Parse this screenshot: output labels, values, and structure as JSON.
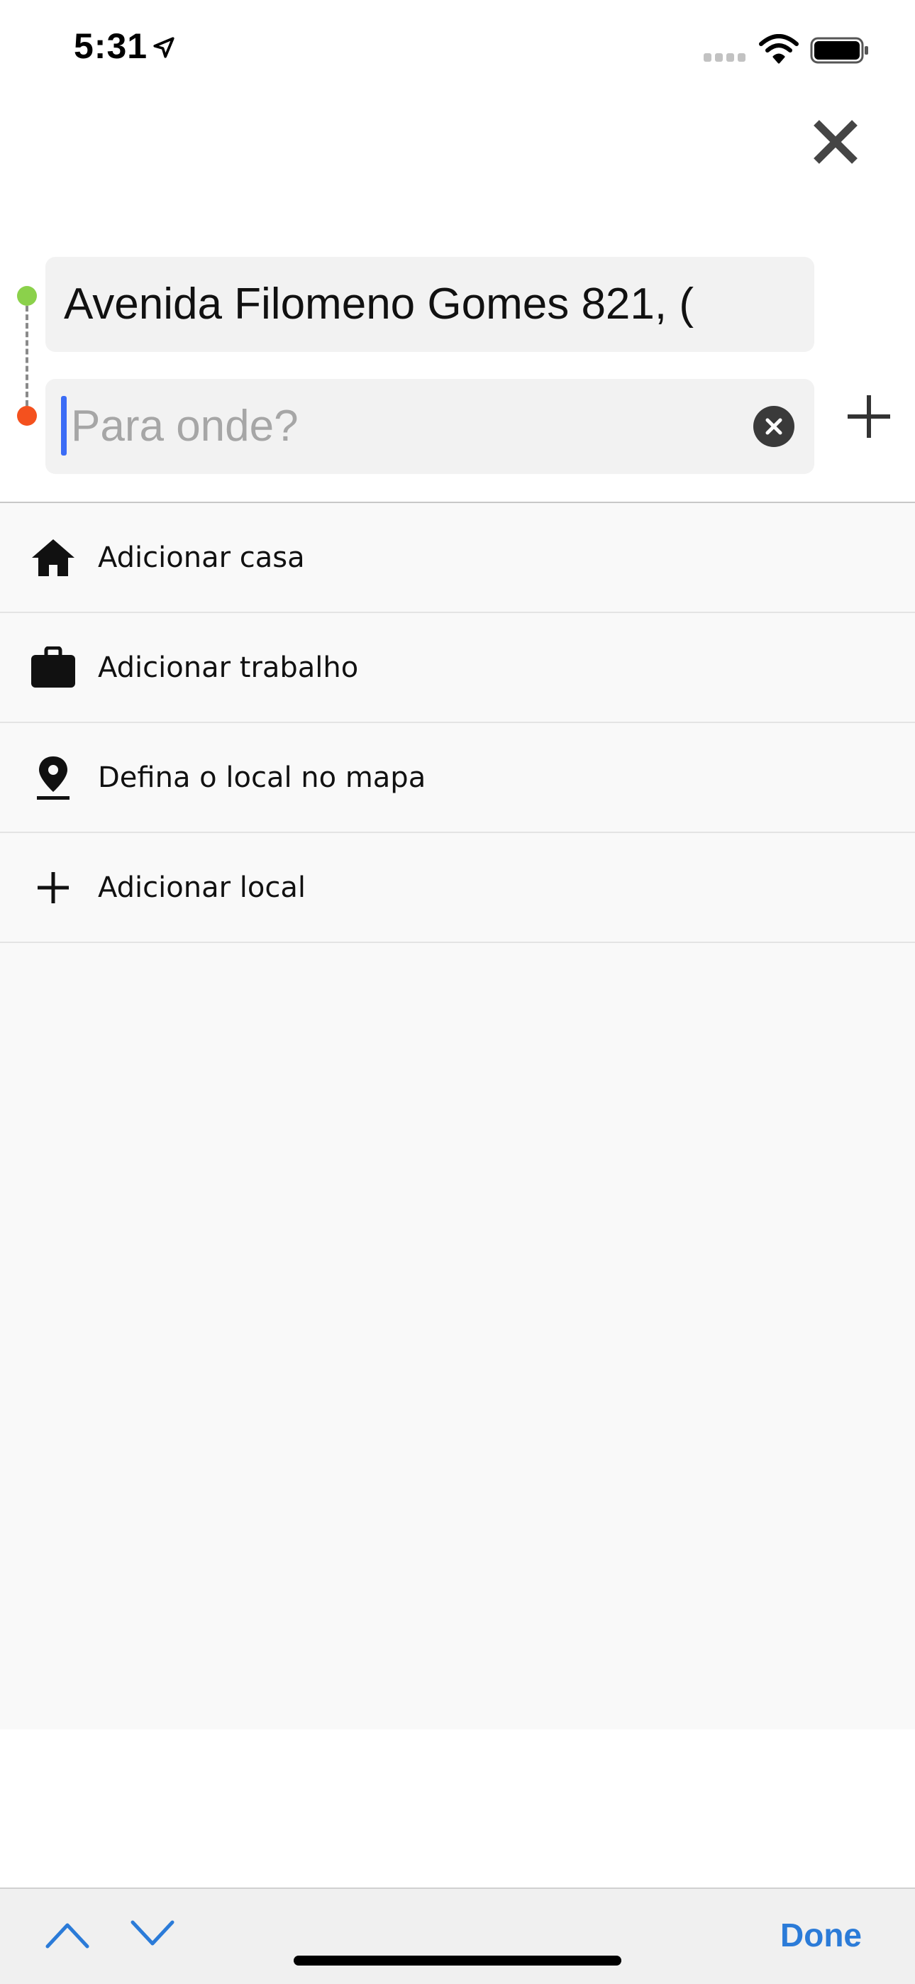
{
  "status_bar": {
    "time": "5:31",
    "location_icon": "location-arrow-icon",
    "signal_icon": "cellular-signal-icon",
    "wifi_icon": "wifi-icon",
    "battery_icon": "battery-icon"
  },
  "header": {
    "close_icon": "close-icon"
  },
  "route": {
    "origin_value": "Avenida Filomeno Gomes 821, (",
    "destination_value": "",
    "destination_placeholder": "Para onde?",
    "clear_icon": "clear-circle-icon",
    "add_stop_icon": "plus-icon",
    "start_color": "#8bd14b",
    "end_color": "#f4511e"
  },
  "list": {
    "items": [
      {
        "label": "Adicionar casa",
        "icon": "home-icon"
      },
      {
        "label": "Adicionar trabalho",
        "icon": "briefcase-icon"
      },
      {
        "label": "Defina o local no mapa",
        "icon": "map-pin-icon"
      },
      {
        "label": "Adicionar local",
        "icon": "plus-icon"
      }
    ]
  },
  "accessory_bar": {
    "prev_icon": "chevron-up-icon",
    "next_icon": "chevron-down-icon",
    "done_label": "Done",
    "accent_color": "#2b7bd8"
  }
}
